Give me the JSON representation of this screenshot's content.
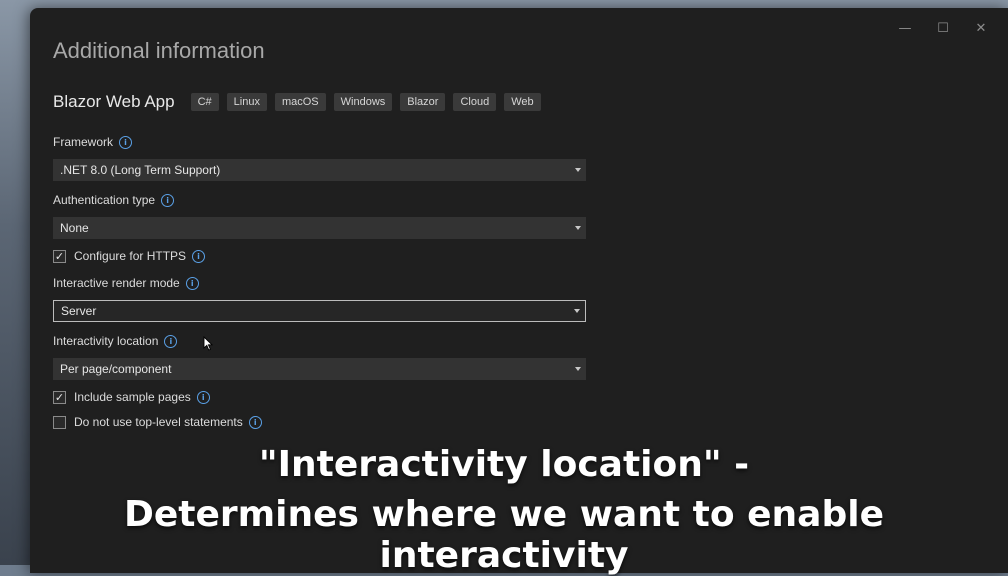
{
  "dialog": {
    "title": "Additional information",
    "window_controls": {
      "minimize": "—",
      "maximize": "☐",
      "close": "✕"
    }
  },
  "project": {
    "name": "Blazor Web App",
    "tags": [
      "C#",
      "Linux",
      "macOS",
      "Windows",
      "Blazor",
      "Cloud",
      "Web"
    ]
  },
  "framework": {
    "label": "Framework",
    "value": ".NET 8.0 (Long Term Support)"
  },
  "authentication": {
    "label": "Authentication type",
    "value": "None"
  },
  "https": {
    "label": "Configure for HTTPS",
    "checked": true
  },
  "render_mode": {
    "label": "Interactive render mode",
    "value": "Server"
  },
  "interactivity_location": {
    "label": "Interactivity location",
    "value": "Per page/component"
  },
  "sample_pages": {
    "label": "Include sample pages",
    "checked": true
  },
  "top_level_statements": {
    "label": "Do not use top-level statements",
    "checked": false
  },
  "caption": {
    "line1": "\"Interactivity location\" -",
    "line2": "Determines where we want to enable interactivity"
  },
  "icons": {
    "info": "info-icon",
    "check": "checkmark-icon",
    "dropdown": "chevron-down-icon",
    "cursor": "mouse-pointer-icon"
  },
  "colors": {
    "window_bg": "#1f1f1f",
    "field_bg": "#333333",
    "info_accent": "#5aa0e6"
  }
}
